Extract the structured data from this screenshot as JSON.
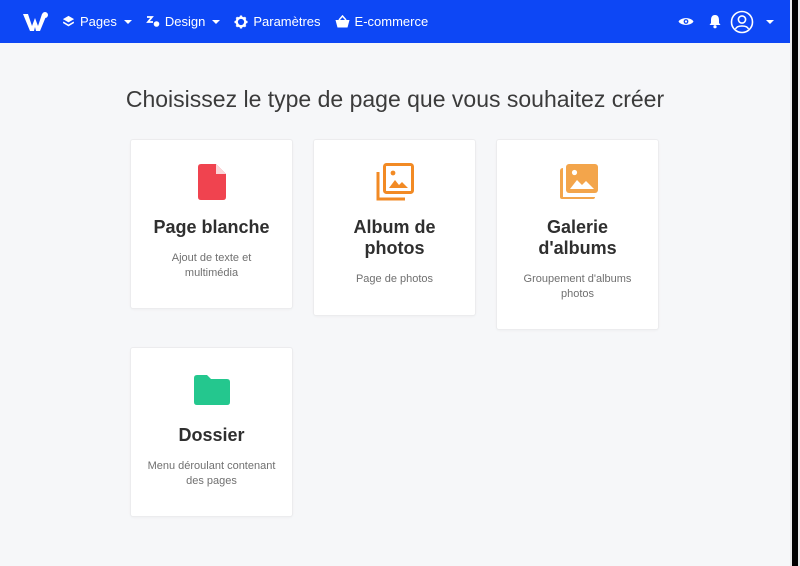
{
  "topbar": {
    "bg_color": "#0d47f5",
    "nav": [
      {
        "label": "Pages",
        "icon": "layers-icon",
        "dropdown": true
      },
      {
        "label": "Design",
        "icon": "design-icon",
        "dropdown": true
      },
      {
        "label": "Paramètres",
        "icon": "gear-icon",
        "dropdown": false
      },
      {
        "label": "E-commerce",
        "icon": "basket-icon",
        "dropdown": false
      }
    ],
    "right": [
      "eye-icon",
      "bell-icon",
      "user-circle-icon",
      "caret-down-icon"
    ]
  },
  "main": {
    "title": "Choisissez le type de page que vous souhaitez créer",
    "cards": [
      {
        "title": "Page blanche",
        "desc": "Ajout de texte et multimédia",
        "icon": "file-icon",
        "color": "#f0434f"
      },
      {
        "title": "Album de photos",
        "desc": "Page de photos",
        "icon": "photo-album-icon",
        "color": "#f28a24"
      },
      {
        "title": "Galerie d'albums",
        "desc": "Groupement d'albums photos",
        "icon": "photo-gallery-icon",
        "color": "#f3a54b"
      },
      {
        "title": "Dossier",
        "desc": "Menu déroulant contenant des pages",
        "icon": "folder-icon",
        "color": "#24c78e"
      }
    ]
  }
}
